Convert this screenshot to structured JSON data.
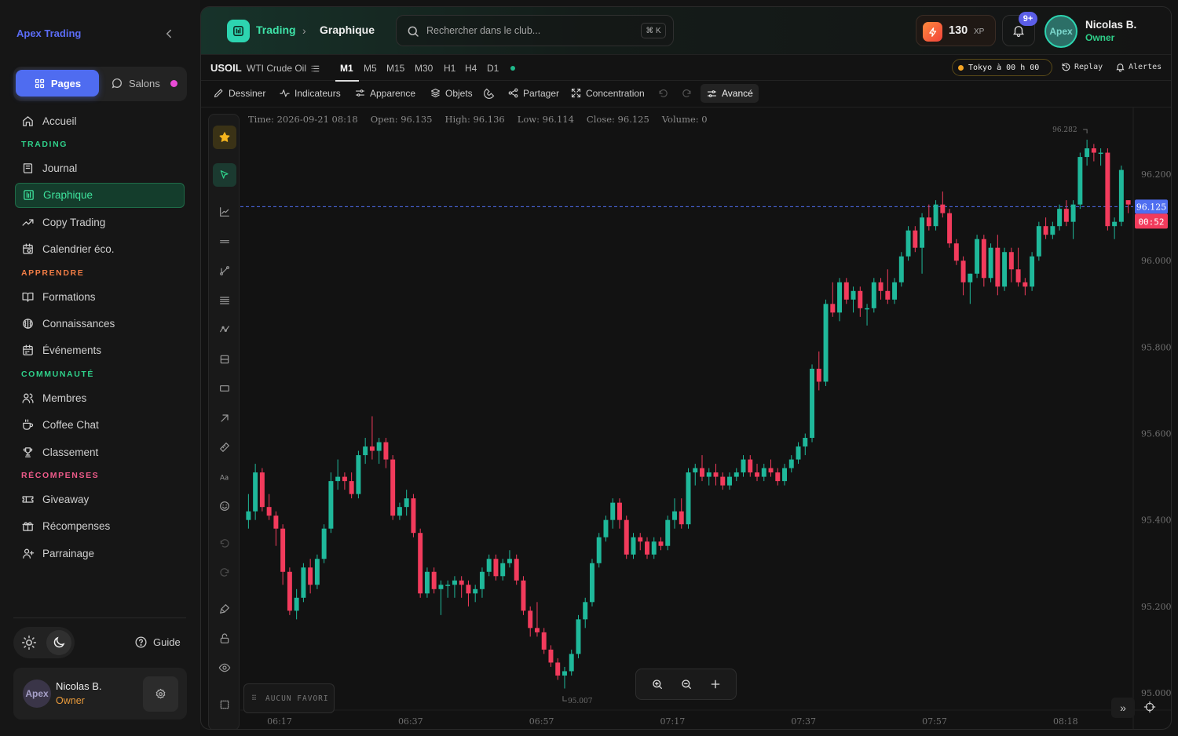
{
  "sidebar": {
    "brand": "Apex Trading",
    "segments": {
      "pages": "Pages",
      "salons": "Salons"
    },
    "items": [
      {
        "label": "Accueil",
        "icon": "home-icon"
      },
      {
        "section": "TRADING"
      },
      {
        "label": "Journal",
        "icon": "book-icon"
      },
      {
        "label": "Graphique",
        "icon": "chart-icon",
        "active": true
      },
      {
        "label": "Copy Trading",
        "icon": "trend-icon"
      },
      {
        "label": "Calendrier éco.",
        "icon": "calendar-icon"
      },
      {
        "section": "APPRENDRE"
      },
      {
        "label": "Formations",
        "icon": "open-book-icon"
      },
      {
        "label": "Connaissances",
        "icon": "brain-icon"
      },
      {
        "label": "Événements",
        "icon": "calendar-event-icon"
      },
      {
        "section": "COMMUNAUTÉ"
      },
      {
        "label": "Membres",
        "icon": "users-icon"
      },
      {
        "label": "Coffee Chat",
        "icon": "coffee-icon"
      },
      {
        "label": "Classement",
        "icon": "trophy-icon"
      },
      {
        "section": "RÉCOMPENSES"
      },
      {
        "label": "Giveaway",
        "icon": "ticket-icon"
      },
      {
        "label": "Récompenses",
        "icon": "gift-icon"
      },
      {
        "label": "Parrainage",
        "icon": "user-plus-icon"
      }
    ],
    "guide": "Guide",
    "user": {
      "avatar": "Apex",
      "name": "Nicolas B.",
      "role": "Owner"
    }
  },
  "header": {
    "breadcrumb": {
      "root": "Trading",
      "current": "Graphique"
    },
    "search": {
      "placeholder": "Rechercher dans le club...",
      "shortcut": "⌘ K"
    },
    "xp": {
      "value": "130",
      "unit": "XP"
    },
    "notifications": "9+",
    "user": {
      "avatar": "Apex",
      "name": "Nicolas B.",
      "role": "Owner"
    }
  },
  "symbol_bar": {
    "symbol": "USOIL",
    "name": "WTI Crude Oil",
    "timeframes": [
      "M1",
      "M5",
      "M15",
      "M30",
      "H1",
      "H4",
      "D1"
    ],
    "active_timeframe": "M1",
    "session": "Tokyo à 00 h 00",
    "replay": "Replay",
    "alerts": "Alertes"
  },
  "toolbar": {
    "draw": "Dessiner",
    "indicators": "Indicateurs",
    "appearance": "Apparence",
    "objects": "Objets",
    "share": "Partager",
    "focus": "Concentration",
    "advanced": "Avancé"
  },
  "ohlc": {
    "time": "Time: 2026-09-21 08:18",
    "open": "Open: 96.135",
    "high": "High: 96.136",
    "low": "Low: 96.114",
    "close": "Close: 96.125",
    "volume": "Volume: 0"
  },
  "favorites": "AUCUN FAVORI",
  "colors": {
    "up": "#1fb89a",
    "down": "#f23b5c",
    "accent": "#2fd08a",
    "price_line": "#4f6ef0"
  },
  "chart_data": {
    "type": "candlestick",
    "symbol": "USOIL",
    "price_ticks": [
      "95.000",
      "95.200",
      "95.400",
      "95.600",
      "95.800",
      "96.000",
      "96.200"
    ],
    "ylim": [
      94.96,
      96.34
    ],
    "time_ticks": [
      "06:17",
      "06:37",
      "06:57",
      "07:17",
      "07:37",
      "07:57",
      "08:18"
    ],
    "last_price": "96.125",
    "countdown": "00:52",
    "high_marker": "96.282",
    "low_marker": "95.007",
    "candles": [
      [
        95.4,
        95.46,
        95.38,
        95.42
      ],
      [
        95.42,
        95.53,
        95.4,
        95.51
      ],
      [
        95.51,
        95.52,
        95.42,
        95.43
      ],
      [
        95.43,
        95.46,
        95.4,
        95.41
      ],
      [
        95.41,
        95.42,
        95.34,
        95.38
      ],
      [
        95.38,
        95.39,
        95.25,
        95.28
      ],
      [
        95.28,
        95.29,
        95.18,
        95.19
      ],
      [
        95.19,
        95.24,
        95.17,
        95.22
      ],
      [
        95.22,
        95.3,
        95.21,
        95.29
      ],
      [
        95.29,
        95.31,
        95.23,
        95.25
      ],
      [
        95.25,
        95.32,
        95.24,
        95.31
      ],
      [
        95.31,
        95.39,
        95.3,
        95.38
      ],
      [
        95.38,
        95.51,
        95.37,
        95.49
      ],
      [
        95.49,
        95.54,
        95.47,
        95.5
      ],
      [
        95.5,
        95.51,
        95.47,
        95.49
      ],
      [
        95.49,
        95.51,
        95.45,
        95.46
      ],
      [
        95.46,
        95.56,
        95.45,
        95.55
      ],
      [
        95.55,
        95.59,
        95.53,
        95.57
      ],
      [
        95.57,
        95.64,
        95.54,
        95.56
      ],
      [
        95.56,
        95.59,
        95.53,
        95.58
      ],
      [
        95.58,
        95.59,
        95.52,
        95.54
      ],
      [
        95.54,
        95.55,
        95.4,
        95.41
      ],
      [
        95.41,
        95.44,
        95.4,
        95.43
      ],
      [
        95.43,
        95.47,
        95.41,
        95.45
      ],
      [
        95.45,
        95.46,
        95.36,
        95.37
      ],
      [
        95.37,
        95.38,
        95.22,
        95.23
      ],
      [
        95.23,
        95.29,
        95.22,
        95.28
      ],
      [
        95.28,
        95.29,
        95.23,
        95.24
      ],
      [
        95.24,
        95.26,
        95.18,
        95.25
      ],
      [
        95.25,
        95.26,
        95.22,
        95.25
      ],
      [
        95.25,
        95.27,
        95.22,
        95.26
      ],
      [
        95.26,
        95.27,
        95.22,
        95.25
      ],
      [
        95.25,
        95.26,
        95.2,
        95.23
      ],
      [
        95.23,
        95.25,
        95.21,
        95.24
      ],
      [
        95.24,
        95.29,
        95.22,
        95.28
      ],
      [
        95.28,
        95.32,
        95.27,
        95.31
      ],
      [
        95.31,
        95.32,
        95.26,
        95.27
      ],
      [
        95.27,
        95.31,
        95.26,
        95.3
      ],
      [
        95.3,
        95.33,
        95.29,
        95.31
      ],
      [
        95.31,
        95.32,
        95.25,
        95.26
      ],
      [
        95.26,
        95.27,
        95.18,
        95.19
      ],
      [
        95.19,
        95.2,
        95.13,
        95.15
      ],
      [
        95.15,
        95.21,
        95.13,
        95.14
      ],
      [
        95.14,
        95.15,
        95.09,
        95.1
      ],
      [
        95.1,
        95.11,
        95.06,
        95.07
      ],
      [
        95.07,
        95.08,
        95.03,
        95.04
      ],
      [
        95.04,
        95.06,
        95.01,
        95.05
      ],
      [
        95.05,
        95.1,
        95.04,
        95.09
      ],
      [
        95.09,
        95.18,
        95.08,
        95.17
      ],
      [
        95.17,
        95.22,
        95.15,
        95.21
      ],
      [
        95.21,
        95.31,
        95.2,
        95.3
      ],
      [
        95.3,
        95.37,
        95.29,
        95.36
      ],
      [
        95.36,
        95.41,
        95.35,
        95.4
      ],
      [
        95.4,
        95.45,
        95.38,
        95.44
      ],
      [
        95.44,
        95.45,
        95.38,
        95.4
      ],
      [
        95.4,
        95.41,
        95.31,
        95.32
      ],
      [
        95.32,
        95.37,
        95.31,
        95.36
      ],
      [
        95.36,
        95.37,
        95.33,
        95.35
      ],
      [
        95.35,
        95.36,
        95.31,
        95.32
      ],
      [
        95.32,
        95.36,
        95.31,
        95.35
      ],
      [
        95.35,
        95.36,
        95.33,
        95.34
      ],
      [
        95.34,
        95.41,
        95.33,
        95.4
      ],
      [
        95.4,
        95.45,
        95.38,
        95.42
      ],
      [
        95.42,
        95.45,
        95.38,
        95.39
      ],
      [
        95.39,
        95.52,
        95.38,
        95.51
      ],
      [
        95.51,
        95.53,
        95.48,
        95.52
      ],
      [
        95.52,
        95.55,
        95.49,
        95.5
      ],
      [
        95.5,
        95.52,
        95.48,
        95.51
      ],
      [
        95.51,
        95.53,
        95.48,
        95.5
      ],
      [
        95.5,
        95.51,
        95.47,
        95.48
      ],
      [
        95.48,
        95.51,
        95.47,
        95.5
      ],
      [
        95.5,
        95.52,
        95.49,
        95.51
      ],
      [
        95.51,
        95.55,
        95.5,
        95.54
      ],
      [
        95.54,
        95.55,
        95.5,
        95.51
      ],
      [
        95.51,
        95.53,
        95.49,
        95.5
      ],
      [
        95.5,
        95.53,
        95.49,
        95.52
      ],
      [
        95.52,
        95.54,
        95.5,
        95.51
      ],
      [
        95.51,
        95.52,
        95.48,
        95.49
      ],
      [
        95.49,
        95.53,
        95.48,
        95.52
      ],
      [
        95.52,
        95.55,
        95.51,
        95.54
      ],
      [
        95.54,
        95.58,
        95.53,
        95.57
      ],
      [
        95.57,
        95.6,
        95.55,
        95.59
      ],
      [
        95.59,
        95.76,
        95.58,
        95.75
      ],
      [
        95.75,
        95.79,
        95.7,
        95.72
      ],
      [
        95.72,
        95.91,
        95.71,
        95.9
      ],
      [
        95.9,
        95.95,
        95.87,
        95.88
      ],
      [
        95.88,
        95.96,
        95.86,
        95.95
      ],
      [
        95.95,
        95.96,
        95.9,
        95.91
      ],
      [
        95.91,
        95.94,
        95.88,
        95.93
      ],
      [
        95.93,
        95.94,
        95.87,
        95.89
      ],
      [
        95.89,
        95.9,
        95.85,
        95.89
      ],
      [
        95.89,
        95.96,
        95.88,
        95.95
      ],
      [
        95.95,
        95.96,
        95.91,
        95.93
      ],
      [
        95.93,
        95.98,
        95.9,
        95.91
      ],
      [
        95.91,
        95.96,
        95.9,
        95.95
      ],
      [
        95.95,
        96.02,
        95.94,
        96.01
      ],
      [
        96.01,
        96.08,
        96.0,
        96.07
      ],
      [
        96.07,
        96.08,
        96.02,
        96.03
      ],
      [
        96.03,
        96.11,
        95.97,
        96.1
      ],
      [
        96.1,
        96.13,
        96.07,
        96.08
      ],
      [
        96.08,
        96.14,
        96.07,
        96.13
      ],
      [
        96.13,
        96.16,
        96.1,
        96.11
      ],
      [
        96.11,
        96.12,
        96.03,
        96.04
      ],
      [
        96.04,
        96.05,
        95.99,
        96.0
      ],
      [
        96.0,
        96.01,
        95.92,
        95.95
      ],
      [
        95.95,
        95.97,
        95.9,
        95.97
      ],
      [
        95.97,
        96.06,
        95.96,
        96.05
      ],
      [
        96.05,
        96.06,
        95.94,
        95.96
      ],
      [
        95.96,
        96.04,
        95.95,
        96.03
      ],
      [
        96.03,
        96.06,
        95.92,
        95.94
      ],
      [
        95.94,
        96.03,
        95.93,
        96.02
      ],
      [
        96.02,
        96.03,
        95.95,
        95.98
      ],
      [
        95.98,
        96.03,
        95.94,
        95.95
      ],
      [
        95.95,
        95.96,
        95.92,
        95.94
      ],
      [
        95.94,
        96.02,
        95.93,
        96.01
      ],
      [
        96.01,
        96.09,
        96.0,
        96.08
      ],
      [
        96.08,
        96.1,
        96.05,
        96.06
      ],
      [
        96.06,
        96.09,
        96.05,
        96.08
      ],
      [
        96.08,
        96.13,
        96.07,
        96.12
      ],
      [
        96.12,
        96.14,
        96.08,
        96.09
      ],
      [
        96.09,
        96.14,
        96.05,
        96.13
      ],
      [
        96.13,
        96.25,
        96.12,
        96.24
      ],
      [
        96.24,
        96.28,
        96.22,
        96.26
      ],
      [
        96.26,
        96.27,
        96.23,
        96.25
      ],
      [
        96.25,
        96.26,
        96.22,
        96.25
      ],
      [
        96.25,
        96.26,
        96.07,
        96.08
      ],
      [
        96.08,
        96.1,
        96.05,
        96.09
      ],
      [
        96.09,
        96.22,
        96.08,
        96.21
      ],
      [
        96.14,
        96.14,
        96.11,
        96.13
      ]
    ]
  }
}
